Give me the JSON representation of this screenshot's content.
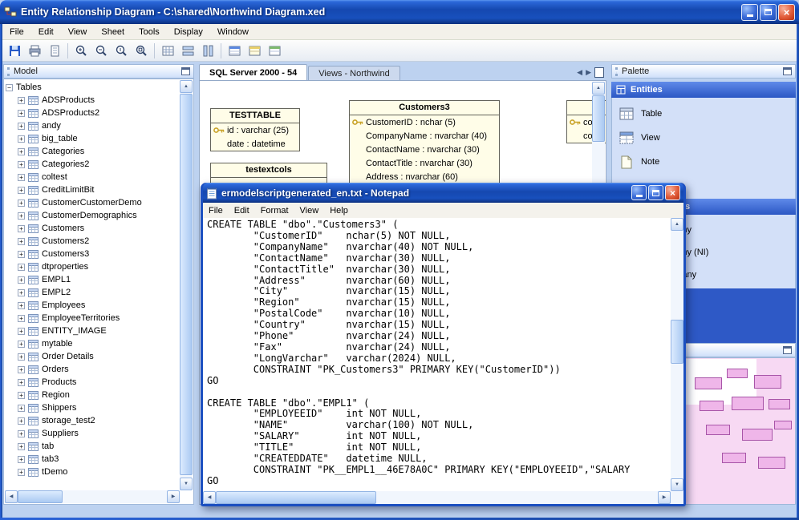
{
  "window": {
    "title": "Entity Relationship Diagram - C:\\shared\\Northwind Diagram.xed"
  },
  "icons": {
    "expand": "+",
    "collapse": "−",
    "close_glyph": "×",
    "tri_up": "▲",
    "tri_down": "▼",
    "tri_left": "◀",
    "tri_right": "▶"
  },
  "colors": {
    "titlebar_blue": "#1548b0",
    "entity_fill": "#fffde8",
    "section_header_blue": "#2b57c4",
    "palette_body": "#d3e0f8",
    "blue_block": "#2e59c6",
    "minimap_pink": "#f7d9f3"
  },
  "menu": {
    "items": [
      "File",
      "Edit",
      "View",
      "Sheet",
      "Tools",
      "Display",
      "Window"
    ]
  },
  "toolbar": {
    "buttons": [
      "save",
      "print",
      "print-preview",
      "zoom-in",
      "zoom-out",
      "zoom-actual",
      "zoom-fit",
      "grid",
      "horizontal-layout",
      "vertical-layout",
      "entity-style-1",
      "entity-style-2",
      "entity-style-3"
    ]
  },
  "model_panel": {
    "title": "Model",
    "root_node": "Tables",
    "tables": [
      "ADSProducts",
      "ADSProducts2",
      "andy",
      "big_table",
      "Categories",
      "Categories2",
      "coltest",
      "CreditLimitBit",
      "CustomerCustomerDemo",
      "CustomerDemographics",
      "Customers",
      "Customers2",
      "Customers3",
      "dtproperties",
      "EMPL1",
      "EMPL2",
      "Employees",
      "EmployeeTerritories",
      "ENTITY_IMAGE",
      "mytable",
      "Order Details",
      "Orders",
      "Products",
      "Region",
      "Shippers",
      "storage_test2",
      "Suppliers",
      "tab",
      "tab3",
      "tDemo"
    ]
  },
  "diagram": {
    "tabs": [
      {
        "label": "SQL Server 2000 - 54"
      },
      {
        "label": "Views - Northwind"
      }
    ],
    "entities": [
      {
        "name": "TESTTABLE",
        "columns": [
          {
            "text": "id : varchar (25)",
            "key": true
          },
          {
            "text": "date : datetime",
            "key": false
          }
        ]
      },
      {
        "name": "testextcols",
        "columns": []
      },
      {
        "name": "Customers3",
        "columns": [
          {
            "text": "CustomerID : nchar (5)",
            "key": true
          },
          {
            "text": "CompanyName : nvarchar (40)",
            "key": false
          },
          {
            "text": "ContactName : nvarchar (30)",
            "key": false
          },
          {
            "text": "ContactTitle : nvarchar (30)",
            "key": false
          },
          {
            "text": "Address : nvarchar (60)",
            "key": false
          }
        ]
      },
      {
        "name": "",
        "columns": [
          {
            "text": "col",
            "key": true
          },
          {
            "text": "col",
            "key": false
          }
        ]
      }
    ]
  },
  "notepad": {
    "title": "ermodelscriptgenerated_en.txt - Notepad",
    "menu": [
      "File",
      "Edit",
      "Format",
      "View",
      "Help"
    ],
    "text": "CREATE TABLE \"dbo\".\"Customers3\" (\n        \"CustomerID\"    nchar(5) NOT NULL,\n        \"CompanyName\"   nvarchar(40) NOT NULL,\n        \"ContactName\"   nvarchar(30) NULL,\n        \"ContactTitle\"  nvarchar(30) NULL,\n        \"Address\"       nvarchar(60) NULL,\n        \"City\"          nvarchar(15) NULL,\n        \"Region\"        nvarchar(15) NULL,\n        \"PostalCode\"    nvarchar(10) NULL,\n        \"Country\"       nvarchar(15) NULL,\n        \"Phone\"         nvarchar(24) NULL,\n        \"Fax\"           nvarchar(24) NULL,\n        \"LongVarchar\"   varchar(2024) NULL,\n        CONSTRAINT \"PK_Customers3\" PRIMARY KEY(\"CustomerID\"))\nGO\n\nCREATE TABLE \"dbo\".\"EMPL1\" (\n        \"EMPLOYEEID\"    int NOT NULL,\n        \"NAME\"          varchar(100) NOT NULL,\n        \"SALARY\"        int NOT NULL,\n        \"TITLE\"         int NOT NULL,\n        \"CREATEDDATE\"   datetime NULL,\n        CONSTRAINT \"PK__EMPL1__46E78A0C\" PRIMARY KEY(\"EMPLOYEEID\",\"SALARY\nGO"
  },
  "palette": {
    "title": "Palette",
    "entities_section": {
      "label": "Entities",
      "items": [
        "Table",
        "View",
        "Note"
      ]
    },
    "relationships_section": {
      "label": "Relationships",
      "items": [
        "One to Many",
        "One to Many (NI)",
        "Many to Many"
      ]
    }
  }
}
